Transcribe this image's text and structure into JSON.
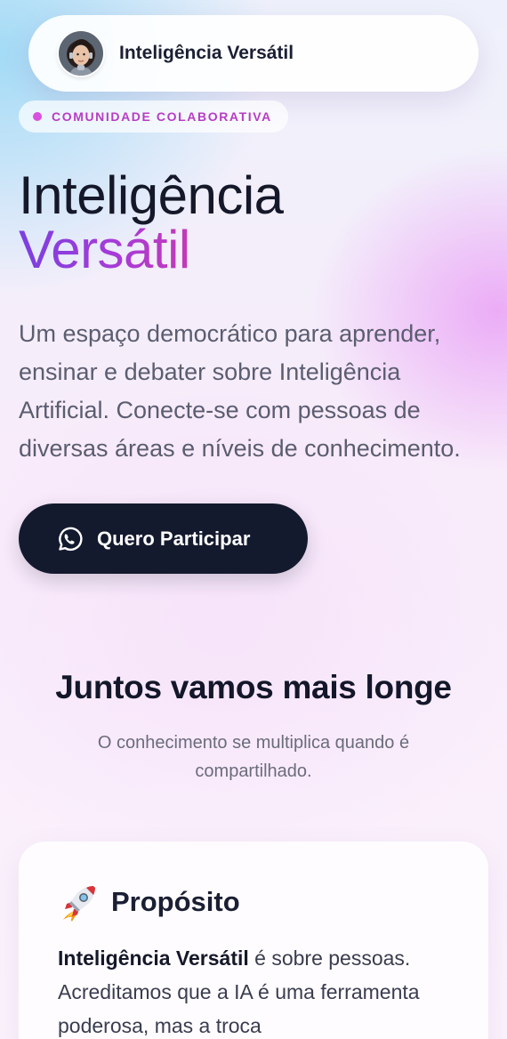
{
  "navbar": {
    "title": "Inteligência Versátil"
  },
  "badge": {
    "label": "COMUNIDADE COLABORATIVA"
  },
  "hero": {
    "title_line1": "Inteligência",
    "title_line2": "Versátil",
    "description": "Um espaço democrático para aprender, ensinar e debater sobre Inteligência Artificial. Conecte-se com pessoas de diversas áreas e níveis de conhecimento.",
    "cta_label": "Quero Participar",
    "cta_icon": "whatsapp-icon"
  },
  "section": {
    "title": "Juntos vamos mais longe",
    "subtitle": "O conhecimento se multiplica quando é compartilhado."
  },
  "card": {
    "icon": "rocket-icon",
    "title": "Propósito",
    "body_strong": "Inteligência Versátil",
    "body_rest": " é sobre pessoas. Acreditamos que a IA é uma ferramenta poderosa, mas a troca"
  },
  "colors": {
    "accent_purple": "#7b3fe0",
    "accent_magenta": "#c43ab6",
    "dark_button": "#141a2e"
  }
}
